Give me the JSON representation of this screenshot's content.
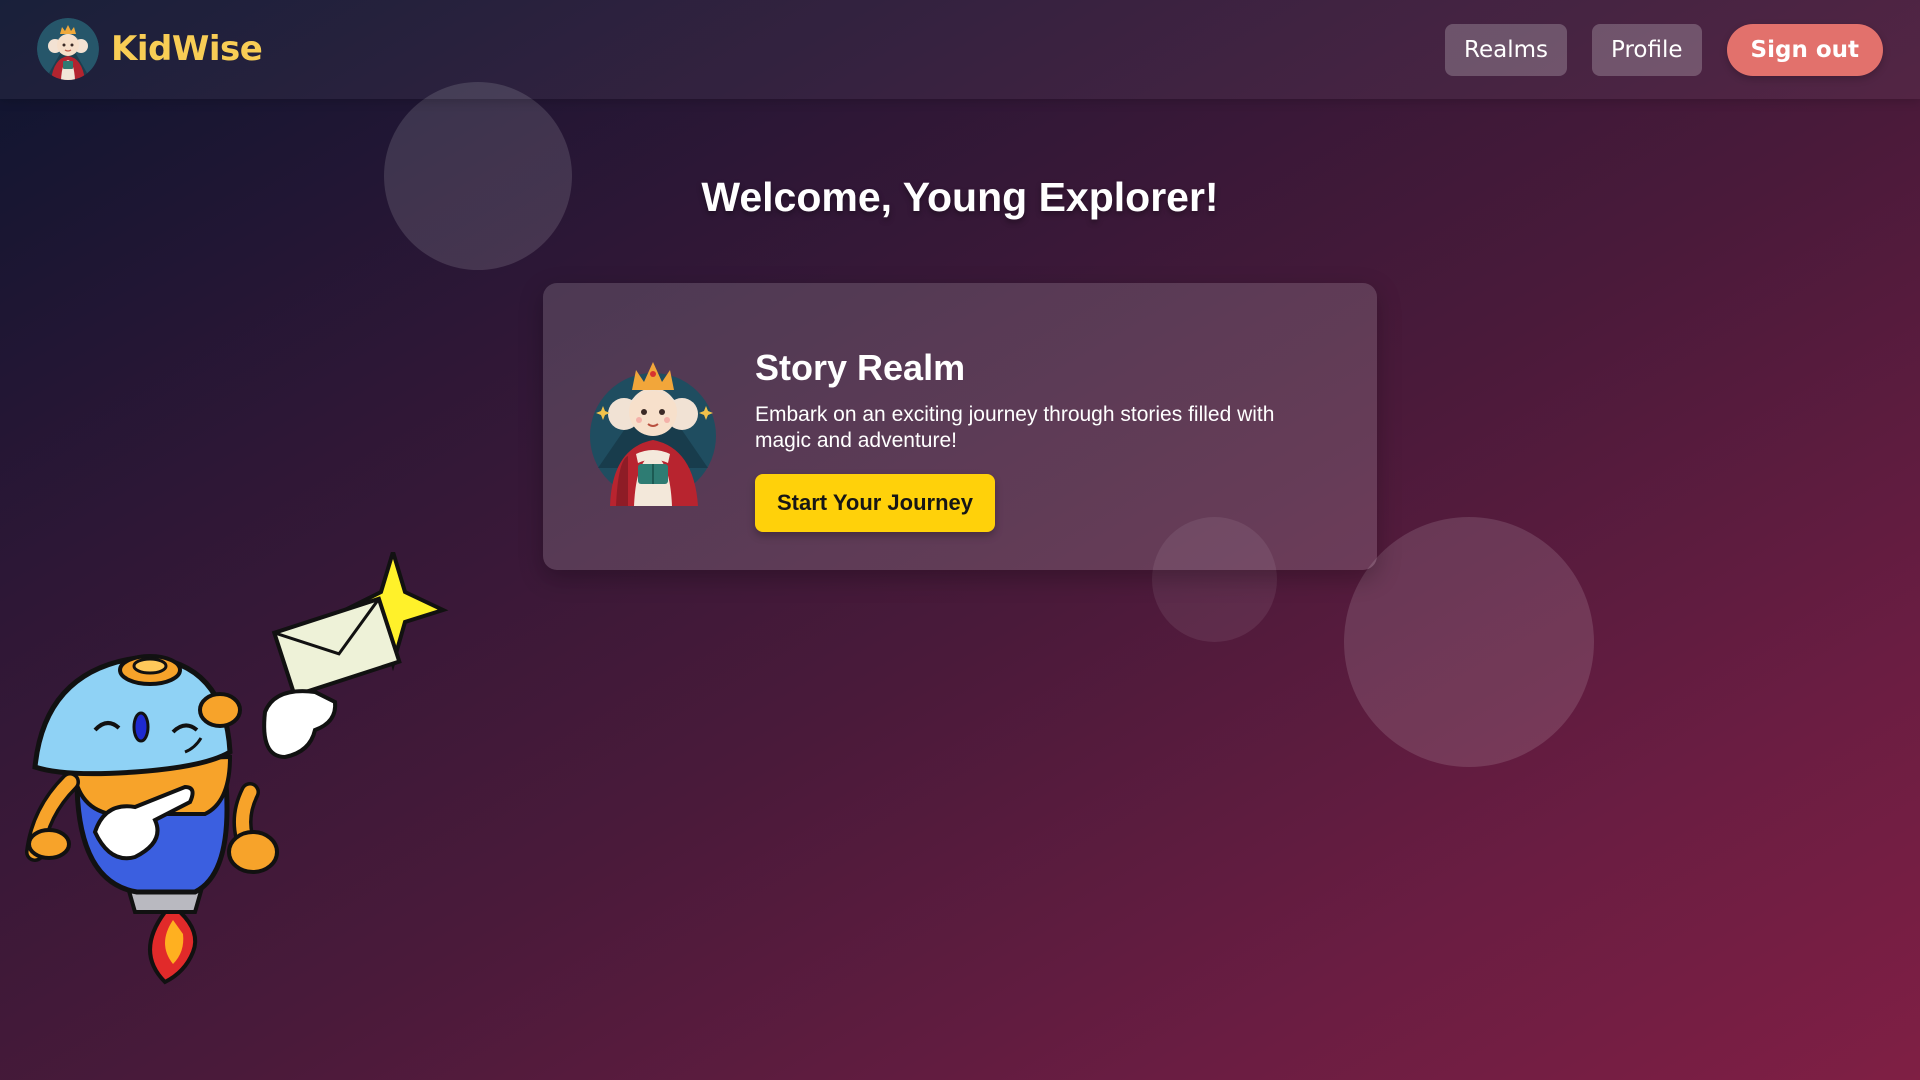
{
  "header": {
    "brand_name": "KidWise",
    "nav": {
      "realms_label": "Realms",
      "profile_label": "Profile",
      "signout_label": "Sign out"
    }
  },
  "main": {
    "welcome_title": "Welcome, Young Explorer!",
    "realm_card": {
      "title": "Story Realm",
      "description": "Embark on an exciting journey through stories filled with magic and adventure!",
      "cta_label": "Start Your Journey"
    }
  },
  "colors": {
    "brand_yellow": "#f8cd55",
    "cta_yellow": "#ffd10a",
    "signout_coral": "#e2716c"
  },
  "icons": {
    "brand_logo": "princess-avatar-icon",
    "card_art": "queen-with-book-icon",
    "mascot": "rocket-mascot-with-letter-icon"
  }
}
